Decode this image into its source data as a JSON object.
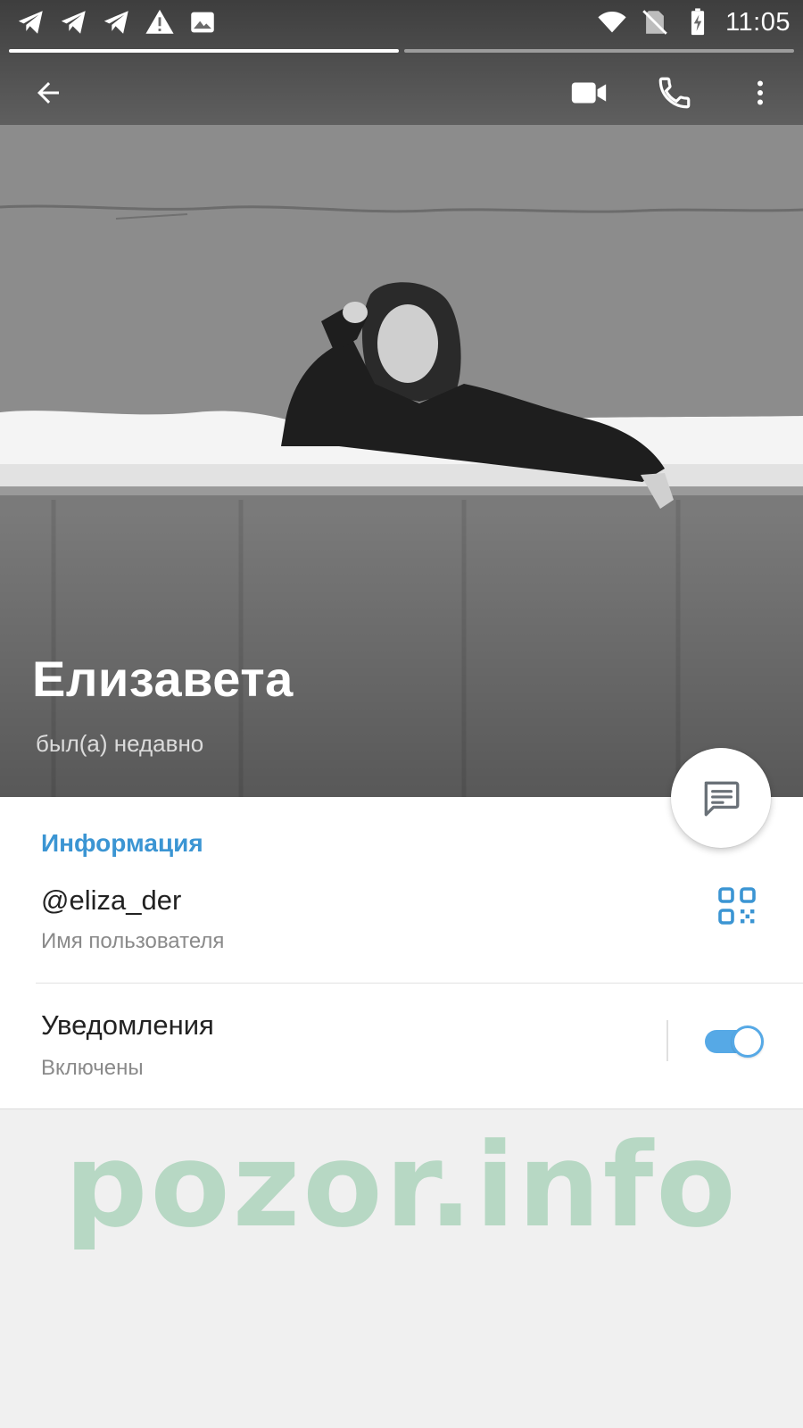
{
  "status_bar": {
    "time": "11:05",
    "left_icons": [
      "telegram-icon",
      "telegram-icon",
      "telegram-icon",
      "warning-icon",
      "image-icon"
    ],
    "right_icons": [
      "wifi-icon",
      "no-sim-icon",
      "battery-charging-icon"
    ]
  },
  "story_progress": {
    "segments": 2,
    "active_index": 0
  },
  "action_bar": {
    "icons": [
      "arrow-left-icon",
      "video-camera-icon",
      "phone-icon",
      "more-vertical-icon"
    ]
  },
  "profile": {
    "name": "Елизавета",
    "status": "был(а) недавно"
  },
  "fab": {
    "icon": "message-icon"
  },
  "info": {
    "section_title": "Информация",
    "username": "@eliza_der",
    "username_label": "Имя пользователя",
    "notifications_title": "Уведомления",
    "notifications_value": "Включены",
    "notifications_enabled": true
  },
  "watermark": "pozor.info",
  "colors": {
    "accent": "#3b95d3",
    "toggle": "#56a9e6",
    "watermark": "#b7d8c4",
    "background": "#f0f0f0"
  }
}
